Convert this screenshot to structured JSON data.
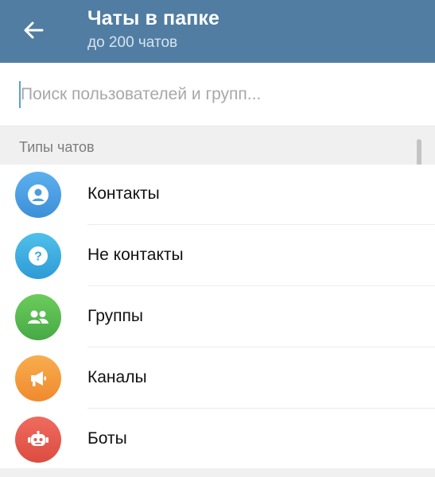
{
  "header": {
    "title": "Чаты в папке",
    "subtitle": "до 200 чатов",
    "back_icon": "arrow-left-icon",
    "background": "#517da2"
  },
  "search": {
    "placeholder": "Поиск пользователей и групп...",
    "value": ""
  },
  "section": {
    "title": "Типы чатов"
  },
  "items": [
    {
      "label": "Контакты",
      "icon": "person-icon",
      "color": "#4a9ee0"
    },
    {
      "label": "Не контакты",
      "icon": "question-icon",
      "color": "#3aa6de"
    },
    {
      "label": "Группы",
      "icon": "group-icon",
      "color": "#56b850"
    },
    {
      "label": "Каналы",
      "icon": "megaphone-icon",
      "color": "#f39a3d"
    },
    {
      "label": "Боты",
      "icon": "bot-icon",
      "color": "#e5594e"
    }
  ]
}
